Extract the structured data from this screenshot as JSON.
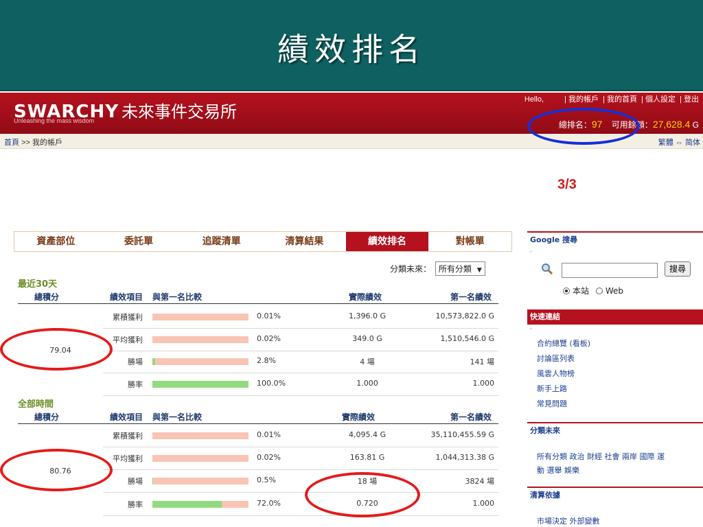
{
  "slide": {
    "title": "績效排名"
  },
  "header": {
    "logo_en": "SWARCHY",
    "logo_zh": "未來事件交易所",
    "tagline": "Unleashing the mass wisdom",
    "links": [
      "Hello,",
      "| 我的帳戶",
      "| 我的首頁",
      "| 個人設定",
      "| 登出"
    ],
    "rank_label": "總排名：",
    "rank_value": "97",
    "balance_label": "可用餘額：",
    "balance_value": "27,628.4",
    "balance_unit": "G"
  },
  "breadcrumb": {
    "home": "首頁",
    "sep": ">>",
    "current": "我的帳戶",
    "lang": "繁體 ⇔ 简体"
  },
  "page_indicator": "3/3",
  "tabs": [
    "資產部位",
    "委託單",
    "追蹤清單",
    "清算結果",
    "績效排名",
    "對帳單"
  ],
  "active_tab": "績效排名",
  "filter": {
    "label": "分類未來：",
    "value": "所有分類"
  },
  "headers": {
    "score": "總積分",
    "item": "績效項目",
    "compare": "與第一名比較",
    "actual": "實際績效",
    "first": "第一名績效"
  },
  "sections": [
    {
      "label": "最近30天",
      "score": "79.04",
      "rows": [
        {
          "metric": "累積獲利",
          "ratio": 0.0001,
          "pct": "0.01%",
          "actual": "1,396.0 G",
          "first": "10,573,822.0 G"
        },
        {
          "metric": "平均獲利",
          "ratio": 0.0002,
          "pct": "0.02%",
          "actual": "349.0 G",
          "first": "1,510,546.0 G"
        },
        {
          "metric": "勝場",
          "ratio": 0.028,
          "pct": "2.8%",
          "actual": "4 場",
          "first": "141 場"
        },
        {
          "metric": "勝率",
          "ratio": 1.0,
          "pct": "100.0%",
          "actual": "1.000",
          "first": "1.000"
        }
      ]
    },
    {
      "label": "全部時間",
      "score": "80.76",
      "rows": [
        {
          "metric": "累積獲利",
          "ratio": 0.0001,
          "pct": "0.01%",
          "actual": "4,095.4 G",
          "first": "35,110,455.59 G"
        },
        {
          "metric": "平均獲利",
          "ratio": 0.0002,
          "pct": "0.02%",
          "actual": "163.81 G",
          "first": "1,044,313.38 G"
        },
        {
          "metric": "勝場",
          "ratio": 0.005,
          "pct": "0.5%",
          "actual": "18 場",
          "first": "3824 場"
        },
        {
          "metric": "勝率",
          "ratio": 0.72,
          "pct": "72.0%",
          "actual": "0.720",
          "first": "1.000"
        }
      ]
    }
  ],
  "sidebar": {
    "search_title": "Google 搜尋",
    "search_button": "搜尋",
    "radio_site": "本站",
    "radio_web": "Web",
    "quick_title": "快速連結",
    "quick_links": [
      "合約總覽 (看板)",
      "討論區列表",
      "風雲人物榜",
      "新手上路",
      "常見問題"
    ],
    "category_title": "分類未來",
    "category_text": "所有分類 政治 財經 社會 兩岸 國際 運",
    "category_text2": "動 選舉 娛樂",
    "settle_title": "清算依據",
    "settle_text": "市場決定 外部變數"
  },
  "colors": {
    "brand_red": "#b5111e",
    "slide_teal": "#0e6160",
    "bar_green": "#8fdb7f",
    "bar_pink": "#f9c4b4"
  }
}
